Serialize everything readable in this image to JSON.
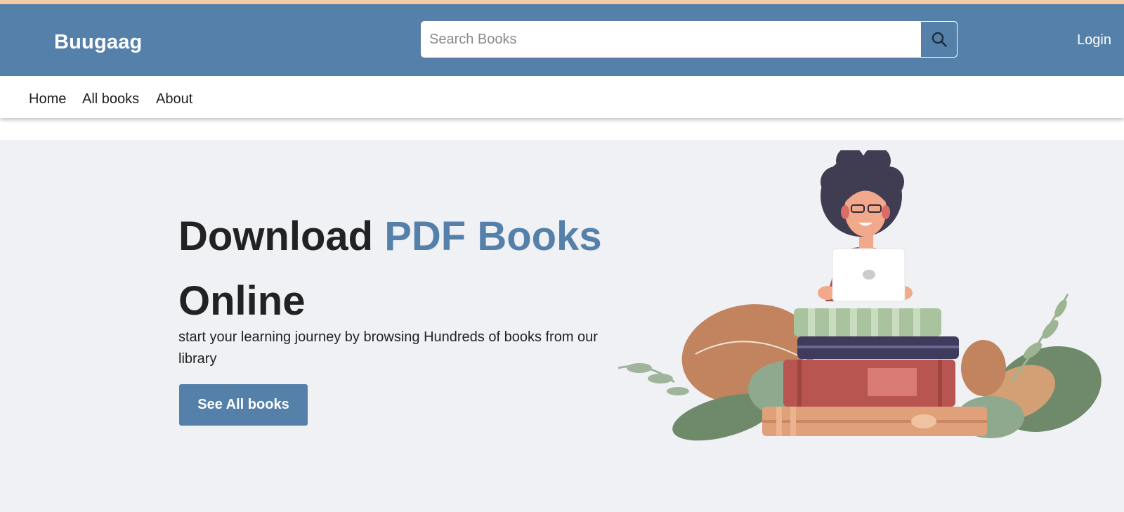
{
  "header": {
    "brand": "Buugaag",
    "search_placeholder": "Search Books",
    "search_icon": "search-icon",
    "login_label": "Login"
  },
  "nav": {
    "items": [
      {
        "label": "Home"
      },
      {
        "label": "All books"
      },
      {
        "label": "About"
      }
    ]
  },
  "hero": {
    "title_part1": "Download ",
    "title_accent": "PDF Books",
    "title_part2": "Online",
    "subtitle": "start your learning journey by browsing Hundreds of books from our library",
    "cta_label": "See All books",
    "illustration": "woman-reading-on-books-illustration"
  },
  "colors": {
    "primary": "#5580a9",
    "hero_bg": "#f0f1f5",
    "top_strip": "#f3cba4",
    "text_dark": "#222222"
  }
}
